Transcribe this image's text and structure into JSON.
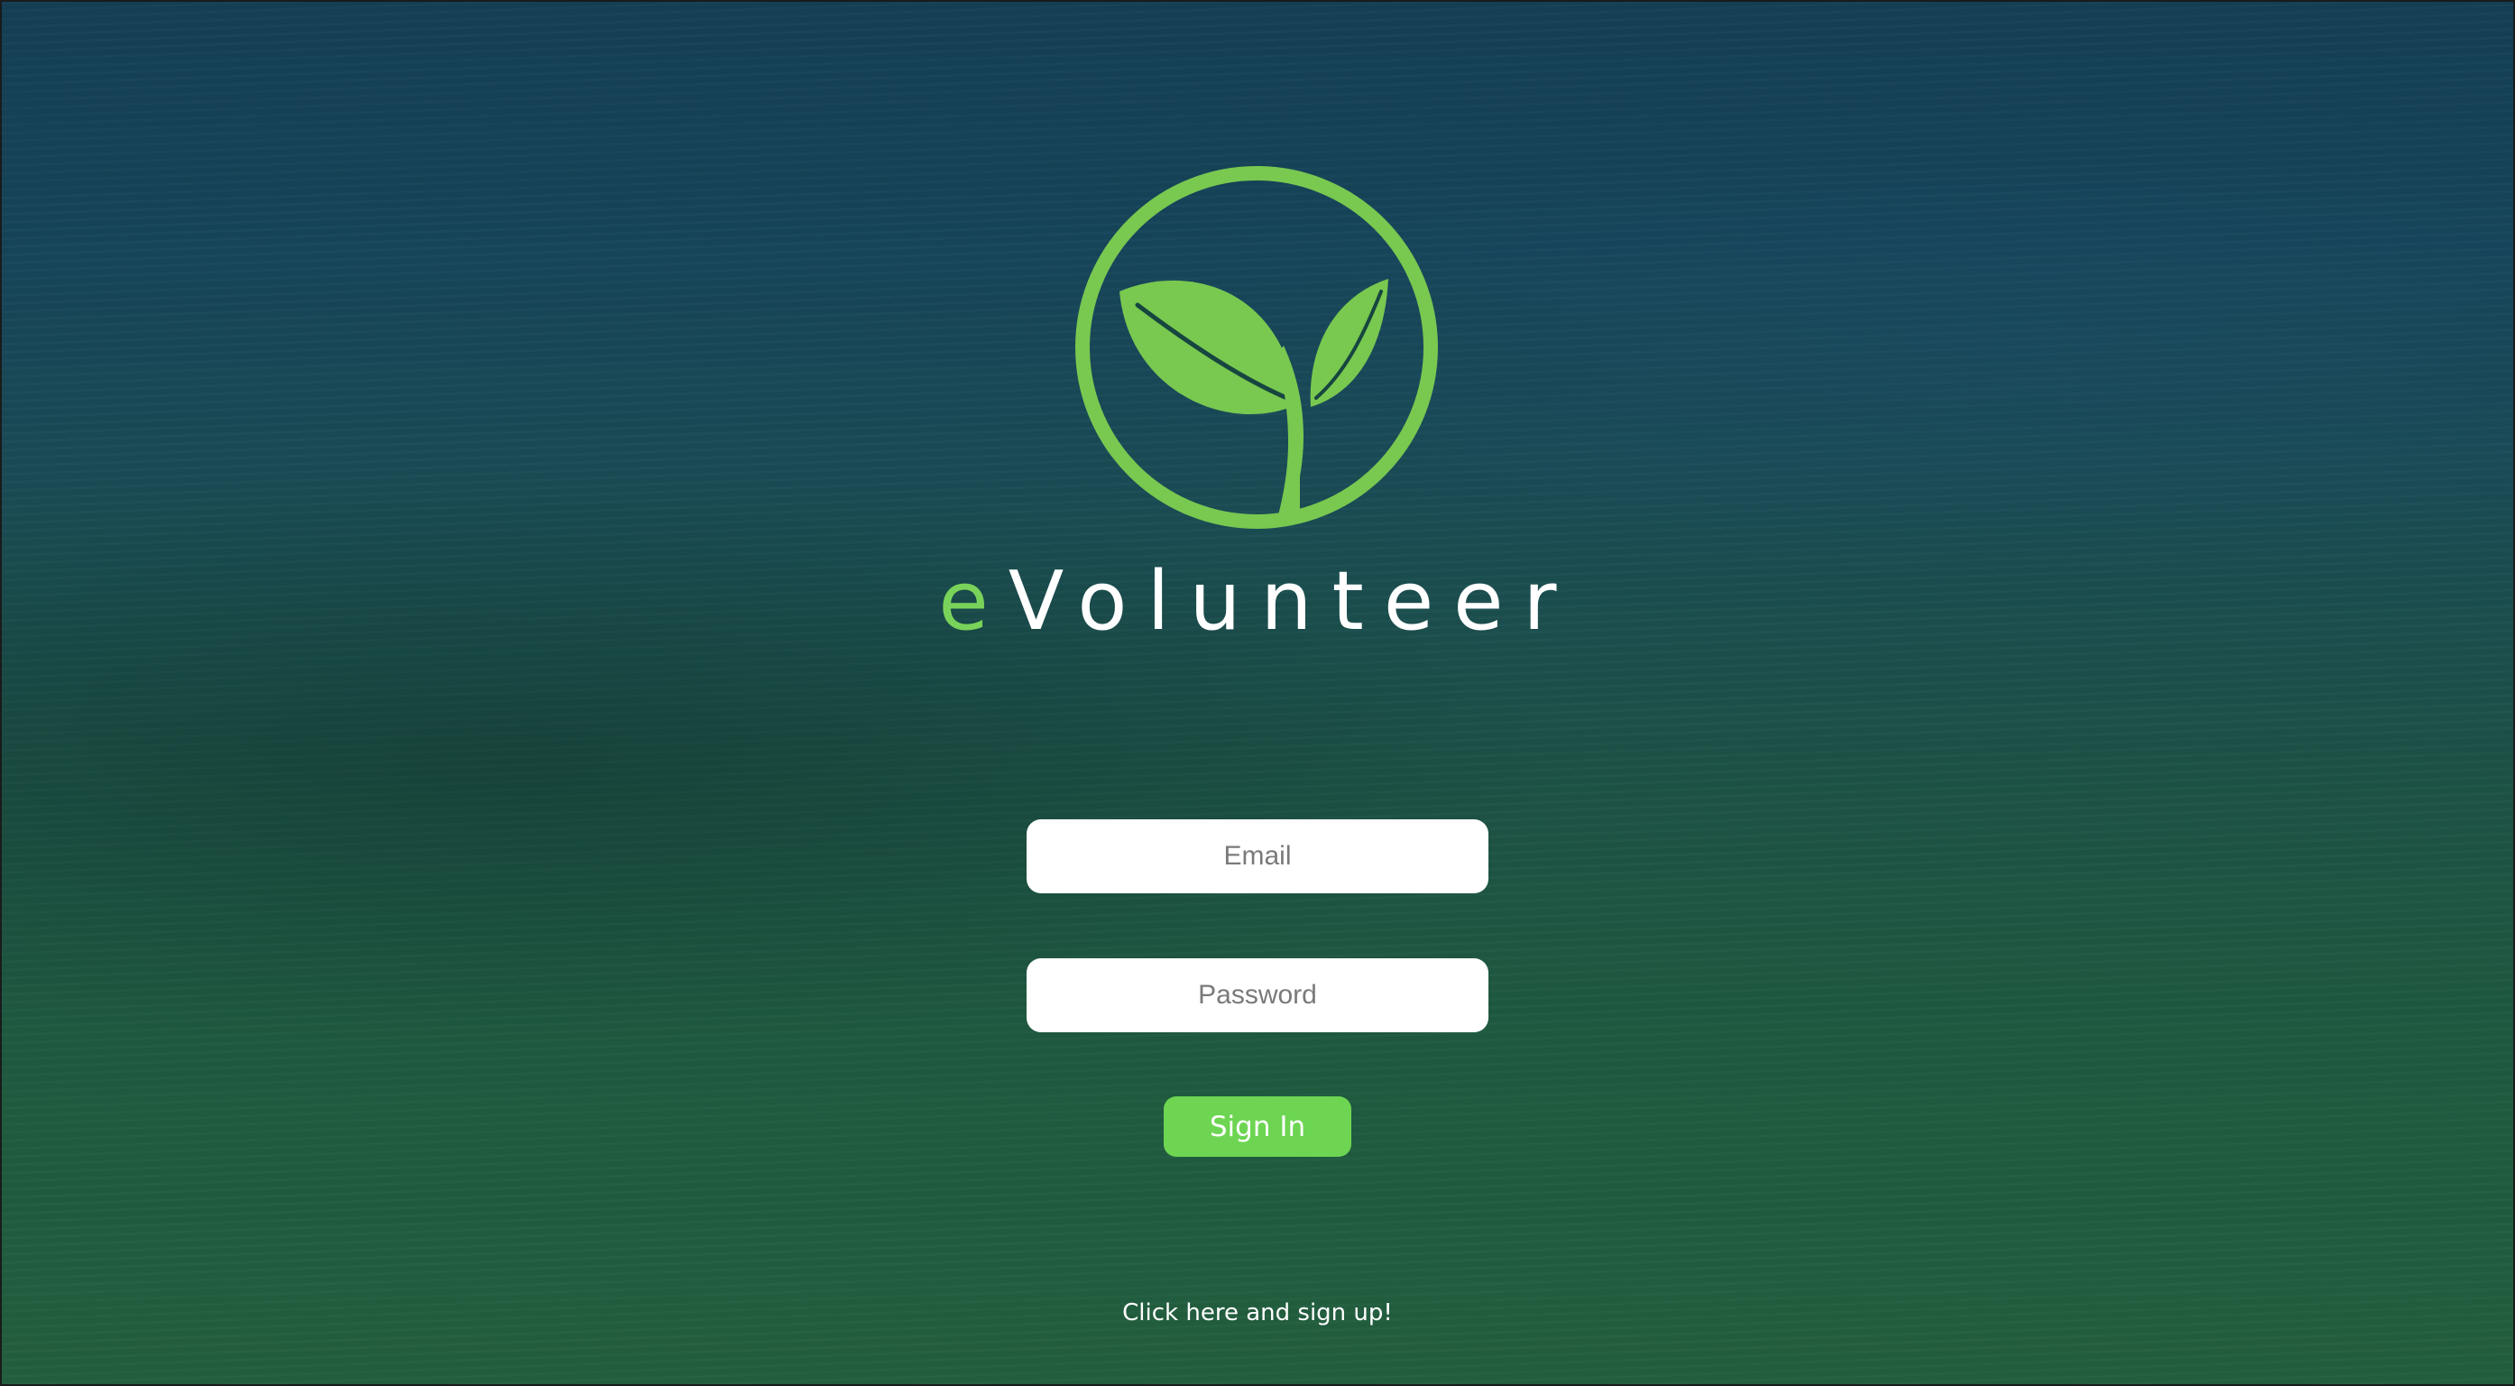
{
  "brand": {
    "prefix": "e",
    "name": "Volunteer",
    "accent_color": "#79d35a",
    "logo_icon": "sprout-leaf-icon"
  },
  "form": {
    "email_placeholder": "Email",
    "password_placeholder": "Password",
    "signin_label": "Sign In",
    "signin_color": "#6dd552"
  },
  "signup": {
    "link_text": "Click here and sign up!"
  }
}
